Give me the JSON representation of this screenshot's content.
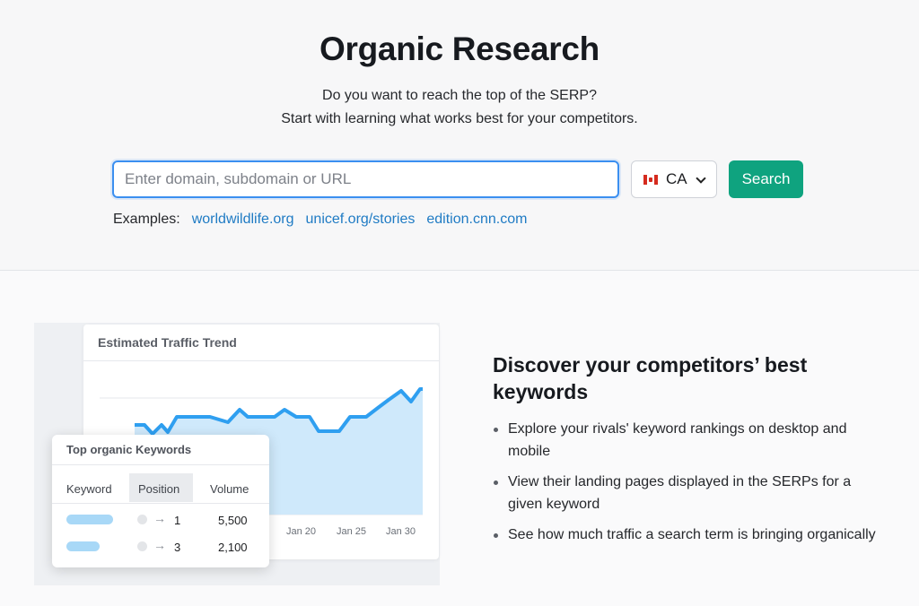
{
  "hero": {
    "title": "Organic Research",
    "subtitle_line1": "Do you want to reach the top of the SERP?",
    "subtitle_line2": "Start with learning what works best for your competitors."
  },
  "search": {
    "placeholder": "Enter domain, subdomain or URL",
    "value": "",
    "country_code": "CA",
    "country_flag_icon": "canada-flag-icon",
    "button_label": "Search",
    "button_color": "#0fa37f"
  },
  "examples": {
    "label": "Examples:",
    "links": [
      "worldwildlife.org",
      "unicef.org/stories",
      "edition.cnn.com"
    ]
  },
  "illustration": {
    "trend_card": {
      "title": "Estimated Traffic Trend",
      "x_labels": [
        "Jan 20",
        "Jan 25",
        "Jan 30"
      ]
    },
    "keywords_card": {
      "title": "Top organic Keywords",
      "headers": [
        "Keyword",
        "Position",
        "Volume"
      ],
      "rows": [
        {
          "position": "1",
          "volume": "5,500"
        },
        {
          "position": "3",
          "volume": "2,100"
        }
      ]
    }
  },
  "discover": {
    "title": "Discover your competitors’ best keywords",
    "bullets": [
      "Explore your rivals' keyword rankings on desktop and mobile",
      "View their landing pages displayed in the SERPs for a given keyword",
      "See how much traffic a search term is bringing organically"
    ]
  }
}
